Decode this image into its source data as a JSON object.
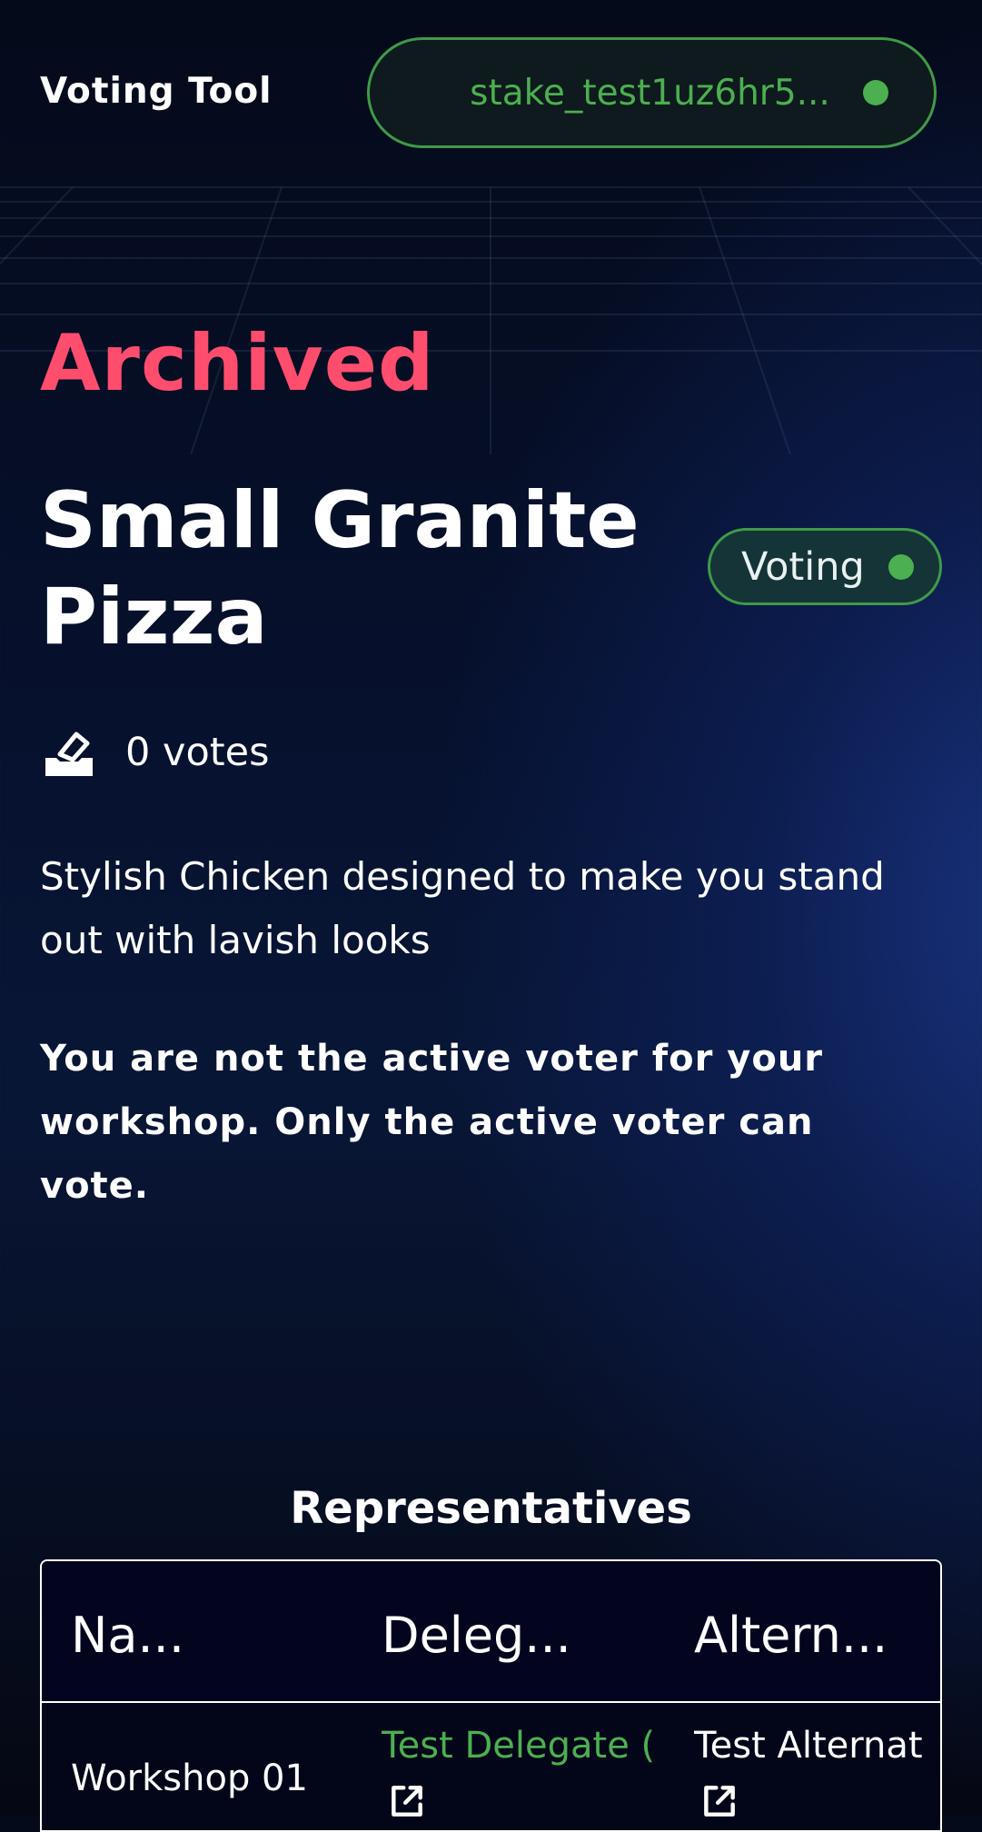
{
  "header": {
    "app_title": "Voting Tool",
    "wallet_address": "stake_test1uz6hr5...",
    "wallet_status_color": "#4caf50"
  },
  "proposal": {
    "status": "Archived",
    "title": "Small Granite Pizza",
    "badge_label": "Voting",
    "votes_text": "0 votes",
    "description": "Stylish Chicken designed to make you stand out with lavish looks",
    "notice": "You are not the active voter for your workshop. Only the active voter can vote."
  },
  "representatives": {
    "title": "Representatives",
    "columns": [
      "Na...",
      "Deleg...",
      "Altern..."
    ],
    "rows": [
      {
        "name": "Workshop 01",
        "delegate": "Test Delegate (",
        "alternate": "Test Alternat"
      }
    ]
  },
  "colors": {
    "accent_green": "#4caf50",
    "status_red": "#ff4d6d",
    "background": "#06112e"
  }
}
